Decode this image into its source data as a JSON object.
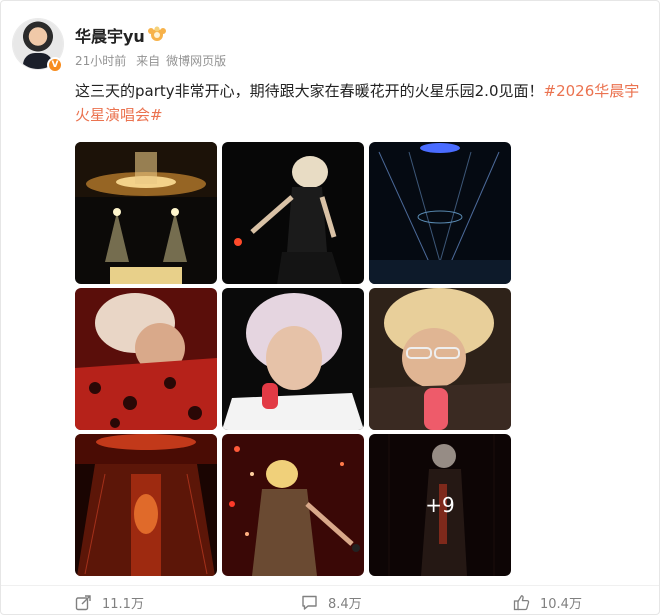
{
  "user": {
    "name": "华晨宇yu",
    "avatar": "avatar-photo",
    "verified_icon": "verified-v-icon",
    "badge_icon": "fan-badge-icon"
  },
  "meta": {
    "time": "21小时前",
    "source_prefix": "来自",
    "source": "微博网页版"
  },
  "post": {
    "text": "这三天的party非常开心，期待跟大家在春暖花开的火星乐园2.0见面！",
    "hashtag": "#2026华晨宇火星演唱会#"
  },
  "images": {
    "more_count": "+9",
    "items": [
      {
        "name": "stage-wide-photo"
      },
      {
        "name": "singer-dancing-photo"
      },
      {
        "name": "stage-lights-photo"
      },
      {
        "name": "singer-red-leopard-photo"
      },
      {
        "name": "singer-white-hair-mic-photo"
      },
      {
        "name": "singer-glasses-mic-photo"
      },
      {
        "name": "red-stage-photo"
      },
      {
        "name": "singer-red-confetti-photo"
      },
      {
        "name": "singer-spotlight-photo"
      }
    ]
  },
  "actions": {
    "share_icon": "share-icon",
    "share_count": "11.1万",
    "comment_icon": "comment-icon",
    "comment_count": "8.4万",
    "like_icon": "thumbs-up-icon",
    "like_count": "10.4万"
  },
  "colors": {
    "hashtag": "#eb7350",
    "verified": "#f78c1e",
    "meta": "#939393"
  }
}
